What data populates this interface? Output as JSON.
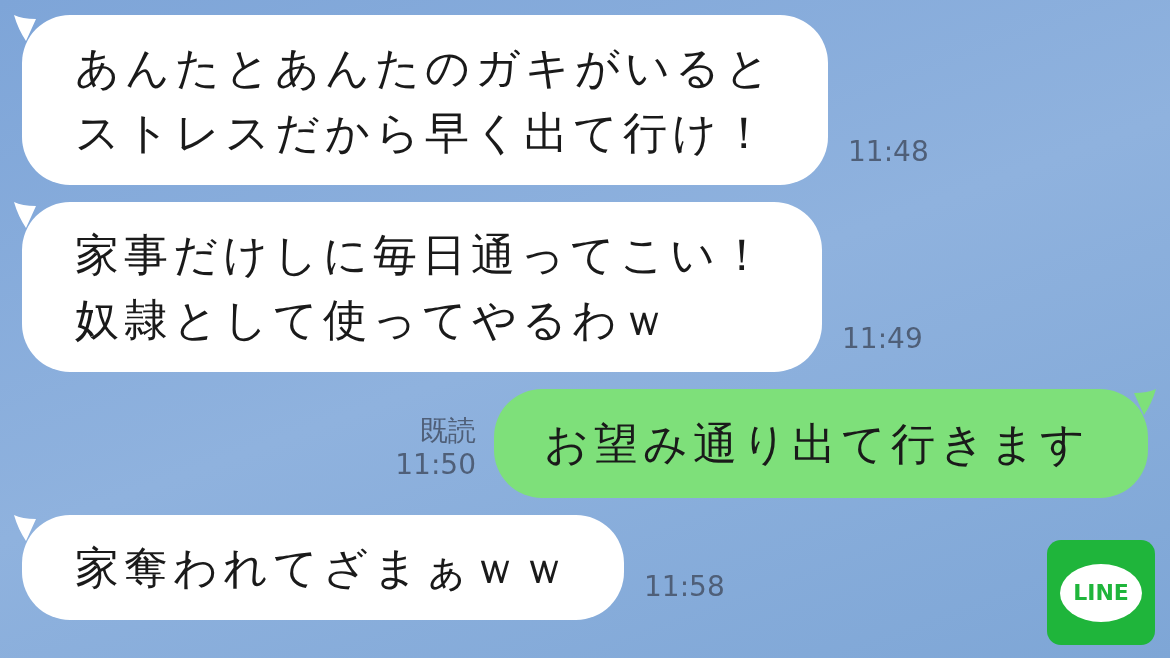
{
  "messages": [
    {
      "kind": "received",
      "lines": [
        "あんたとあんたのガキがいると",
        "ストレスだから早く出て行け！"
      ],
      "time": "11:48"
    },
    {
      "kind": "received",
      "lines": [
        "家事だけしに毎日通ってこい！",
        "奴隷として使ってやるわｗ"
      ],
      "time": "11:49"
    },
    {
      "kind": "sent",
      "lines": [
        "お望み通り出て行きます"
      ],
      "time": "11:50",
      "read": "既読"
    },
    {
      "kind": "received",
      "lines": [
        "家奪われてざまぁｗｗ"
      ],
      "time": "11:58"
    }
  ],
  "logo": {
    "text": "LINE"
  }
}
